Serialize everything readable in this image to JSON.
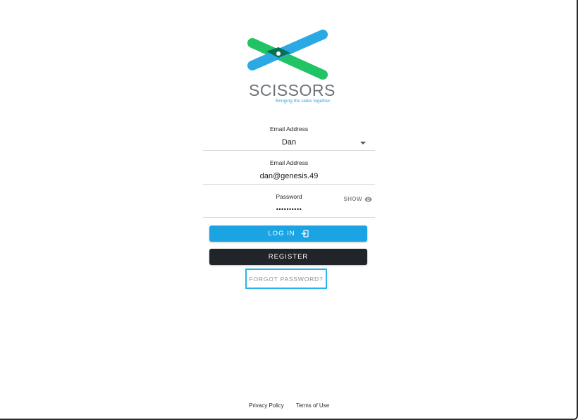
{
  "brand": {
    "name": "SCISSORS",
    "tagline": "Bringing the sides together.",
    "colors": {
      "green": "#20c465",
      "blue": "#2ba9e5",
      "overlap": "#0c6f52"
    }
  },
  "form": {
    "user_field": {
      "label": "Email Address",
      "value": "Dan"
    },
    "email_field": {
      "label": "Email Address",
      "value": "dan@genesis.49"
    },
    "password_field": {
      "label": "Password",
      "value": "••••••••••",
      "show_label": "SHOW"
    }
  },
  "buttons": {
    "login": "LOG IN",
    "register": "REGISTER",
    "forgot": "FORGOT PASSWORD?"
  },
  "footer": {
    "privacy": "Privacy Policy",
    "terms": "Terms of Use"
  },
  "icons": {
    "dropdown": "chevron-down-icon",
    "show": "eye-icon",
    "login": "login-icon"
  }
}
